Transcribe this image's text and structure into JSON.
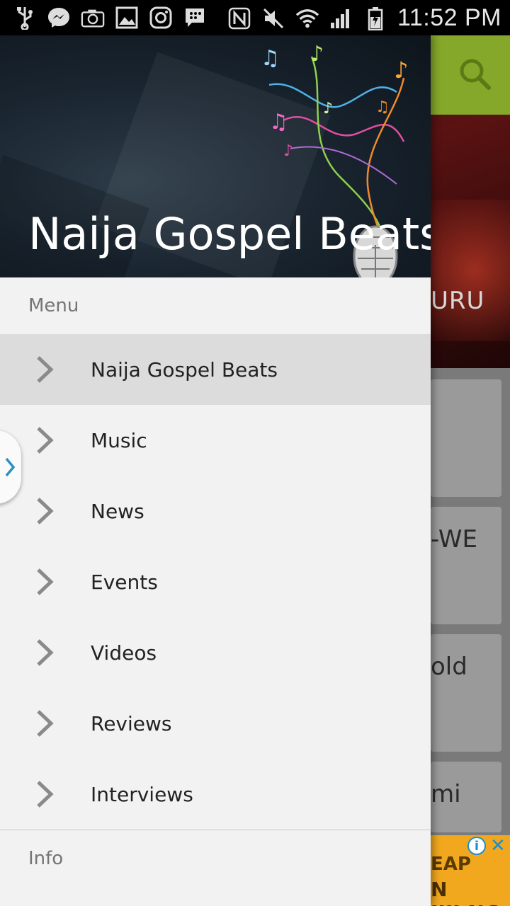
{
  "status_bar": {
    "time": "11:52 PM",
    "left_icons": [
      "usb-icon",
      "messenger-icon",
      "camera-icon",
      "gallery-icon",
      "instagram-icon",
      "bbm-icon"
    ],
    "right_icons": [
      "nfc-icon",
      "mute-icon",
      "wifi-icon",
      "signal-icon",
      "battery-icon"
    ]
  },
  "drawer": {
    "header_title": "Naija Gospel Beats",
    "section_menu": "Menu",
    "items": [
      {
        "label": "Naija Gospel Beats",
        "active": true
      },
      {
        "label": "Music"
      },
      {
        "label": "News"
      },
      {
        "label": "Events"
      },
      {
        "label": "Videos"
      },
      {
        "label": "Reviews"
      },
      {
        "label": "Interviews"
      }
    ],
    "section_info": "Info"
  },
  "background": {
    "hero_text": "URU",
    "card_texts": [
      "-WE",
      "old",
      "mi"
    ],
    "ad": {
      "line1": "EAP",
      "line2": "N JIJI.NG"
    },
    "accent_green": "#86a82a",
    "ad_color": "#f2a81e"
  }
}
